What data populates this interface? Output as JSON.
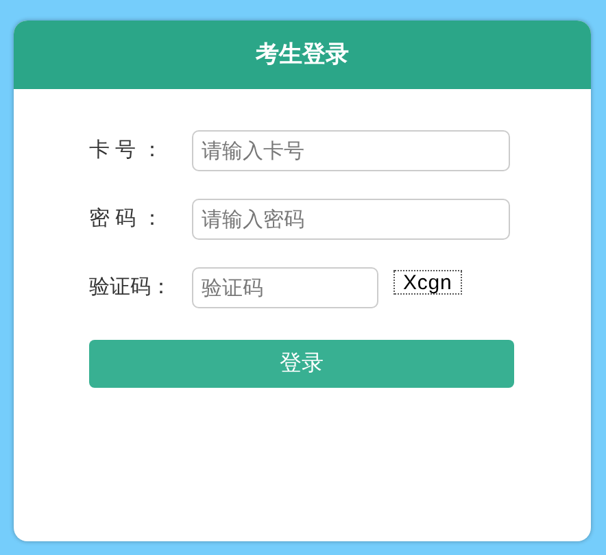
{
  "title": "考生登录",
  "fields": [
    {
      "label": "卡 号 ：",
      "placeholder": "请输入卡号",
      "kind": "text"
    },
    {
      "label": "密 码 ：",
      "placeholder": "请输入密码",
      "kind": "password"
    },
    {
      "label": "验证码：",
      "placeholder": "验证码",
      "kind": "captcha",
      "captcha": "Xcgn"
    }
  ],
  "button": "登录"
}
